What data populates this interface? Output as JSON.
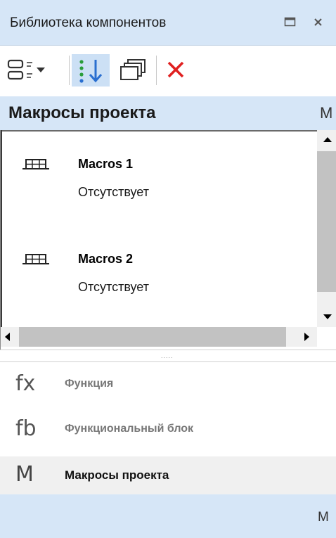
{
  "window": {
    "title": "Библиотека компонентов"
  },
  "toolbar": {
    "buttons": [
      {
        "name": "view-mode",
        "icon": "list-view-icon",
        "dropdown": true
      },
      {
        "name": "sort",
        "icon": "sort-icon",
        "active": true
      },
      {
        "name": "copy",
        "icon": "stack-copy-icon"
      },
      {
        "name": "delete",
        "icon": "close-red-icon",
        "color": "#e02020"
      }
    ]
  },
  "section": {
    "title": "Макросы проекта",
    "letter": "M"
  },
  "macros": [
    {
      "name": "Macros 1",
      "description": "Отсутствует"
    },
    {
      "name": "Macros 2",
      "description": "Отсутствует"
    }
  ],
  "splitter": {
    "grip": "....."
  },
  "categories": [
    {
      "icon_text": "fx",
      "label": "Функция"
    },
    {
      "icon_text": "fb",
      "label": "Функциональный блок"
    },
    {
      "icon_text": "M",
      "label": "Макросы проекта",
      "active": true
    }
  ],
  "bottom": {
    "letter": "M"
  },
  "colors": {
    "header_bg": "#d6e6f7",
    "accent_red": "#e02020",
    "active_blue": "#2a6fd0"
  }
}
